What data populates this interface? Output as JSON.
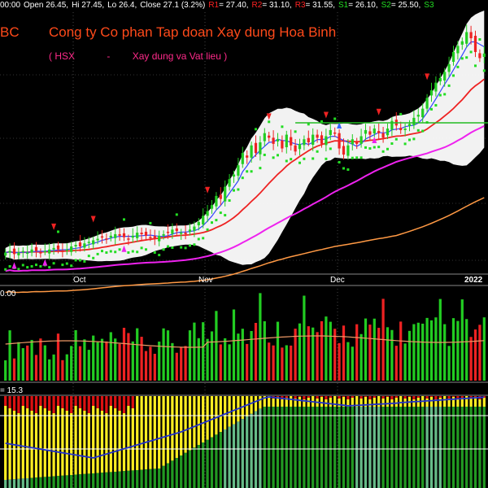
{
  "header": {
    "time_suffix": "00:00",
    "open": "Open 26.45,",
    "high": "Hi 27.45,",
    "low": "Lo 26.4,",
    "close": "Close 27.1 (3.2%)",
    "r1_label": "R1",
    "r1_value": "= 27.40,",
    "r2_label": "R2",
    "r2_value": "= 31.10,",
    "r3_label": "R3",
    "r3_value": "= 31.55,",
    "s1_label": "S1",
    "s1_value": "= 26.10,",
    "s2_label": "S2",
    "s2_value": "= 25.50,",
    "s3_label": "S3"
  },
  "ticker_fragment": "BC",
  "company_name": "Cong ty Co phan Tap doan Xay dung Hoa Binh",
  "exchange": "( HSX",
  "dash": "-",
  "sector": "Xay dung va Vat lieu )",
  "volume_label": "0.00",
  "mfi_label": "= 15.3",
  "months": [
    "Oct",
    "Nov",
    "Dec",
    "2022"
  ],
  "colors": {
    "up": "#22cc22",
    "down": "#ee2222",
    "band": "#ffffff",
    "ma_fast": "#3344ff",
    "ma_mid": "#ee2222",
    "ma_slow": "#ee22ee",
    "ma_long": "#ff9944",
    "sar": "#22dd22",
    "mfi_yellow": "#ffee22",
    "mfi_green": "#229922",
    "mfi_light": "#66bb88",
    "mfi_red": "#dd1111"
  },
  "chart_data": {
    "type": "candlestick",
    "note_series": [
      "close"
    ],
    "close": [
      24.8,
      24.9,
      24.7,
      24.8,
      24.9,
      24.8,
      25.0,
      24.9,
      24.8,
      24.9,
      25.0,
      25.1,
      25.0,
      24.9,
      25.0,
      25.2,
      25.3,
      25.2,
      25.4,
      25.5,
      25.6,
      25.7,
      25.8,
      25.7,
      25.9,
      26.0,
      25.9,
      25.8,
      25.7,
      25.9,
      26.1,
      26.0,
      25.9,
      25.8,
      25.7,
      25.9,
      26.0,
      26.1,
      26.3,
      26.2,
      26.1,
      26.0,
      26.3,
      26.5,
      26.8,
      27.2,
      27.5,
      27.9,
      28.5,
      28.3,
      29.1,
      29.6,
      29.9,
      30.5,
      31.3,
      31.0,
      31.8,
      31.3,
      32.0,
      32.6,
      32.3,
      31.9,
      32.2,
      31.6,
      32.5,
      31.8,
      31.4,
      31.9,
      32.2,
      32.0,
      32.5,
      32.3,
      31.9,
      32.4,
      32.8,
      32.6,
      31.6,
      31.2,
      31.8,
      32.2,
      31.9,
      32.4,
      32.8,
      32.5,
      32.9,
      32.6,
      32.3,
      32.9,
      33.4,
      33.1,
      32.8,
      32.9,
      33.2,
      33.6,
      33.8,
      34.2,
      34.9,
      35.4,
      35.9,
      36.2,
      36.6,
      37.1,
      37.9,
      38.3,
      38.6,
      39.2,
      38.8,
      37.9,
      37.5,
      37.8
    ],
    "volume_max_label": "",
    "mfi_value": 15.3
  }
}
